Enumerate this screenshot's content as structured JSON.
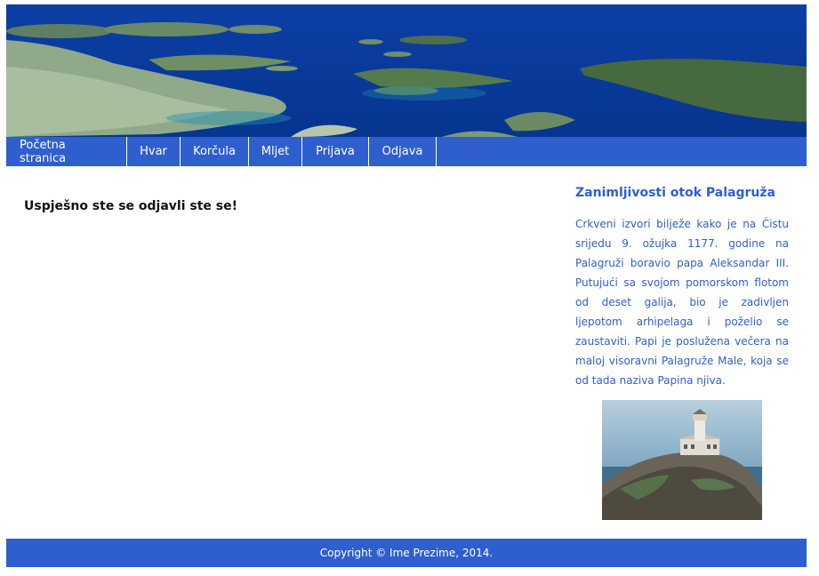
{
  "nav": {
    "items": [
      "Početna stranica",
      "Hvar",
      "Korčula",
      "Mljet",
      "Prijava",
      "Odjava"
    ]
  },
  "main": {
    "message": "Uspješno ste se odjavli ste se!"
  },
  "sidebar": {
    "title": "Zanimljivosti otok Palagruža",
    "text": "Crkveni izvori bilježe kako je na Čistu srijedu 9. ožujka 1177. godine na Palagruži boravio papa Aleksandar III. Putujući sa svojom pomorskom flotom od deset galija, bio je zadivljen ljepotom arhipelaga i poželio se zaustaviti. Papi je poslužena večera na maloj visoravni Palagruže Male, koja se od tada naziva Papina njiva."
  },
  "footer": {
    "copyright": "Copyright © Ime Prezime, 2014."
  },
  "colors": {
    "accent": "#2f5fcf",
    "sea": "#0a3f9a"
  }
}
